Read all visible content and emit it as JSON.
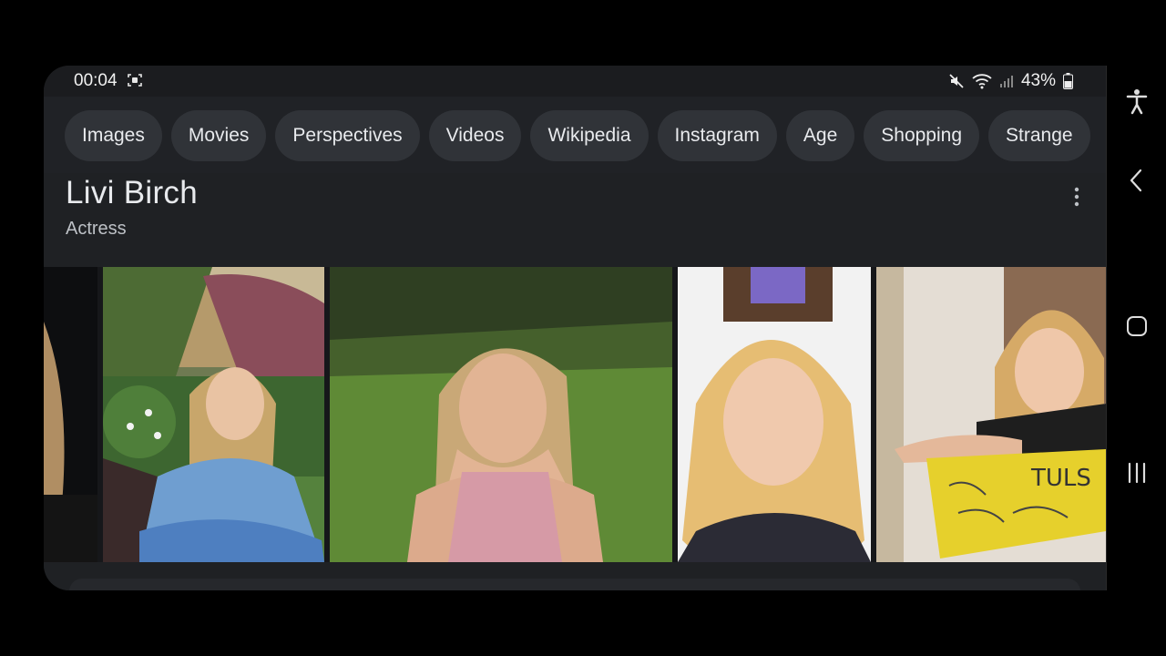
{
  "status_bar": {
    "time": "00:04",
    "battery": "43%",
    "icons": [
      "screen-record-icon",
      "mute-icon",
      "wifi-icon",
      "signal-icon",
      "battery-icon"
    ]
  },
  "chips": [
    {
      "label": "Images"
    },
    {
      "label": "Movies"
    },
    {
      "label": "Perspectives"
    },
    {
      "label": "Videos"
    },
    {
      "label": "Wikipedia"
    },
    {
      "label": "Instagram"
    },
    {
      "label": "Age"
    },
    {
      "label": "Shopping"
    },
    {
      "label": "Strange"
    }
  ],
  "knowledge_panel": {
    "title": "Livi Birch",
    "subtitle": "Actress",
    "menu_icon": "more-vert-icon"
  },
  "images": [
    {
      "description": "partial-photo"
    },
    {
      "description": "girl-in-blue-dress-garden"
    },
    {
      "description": "girl-smiling-on-lawn"
    },
    {
      "description": "girl-headshot-event"
    },
    {
      "description": "girl-with-yellow-sign"
    }
  ],
  "colors": {
    "background": "#1f2124",
    "chip": "#303338",
    "text": "#e8eaed",
    "secondary_text": "#bdc1c6"
  },
  "nav_bar": {
    "icons": [
      "accessibility-icon",
      "back-icon",
      "home-icon",
      "recents-icon"
    ]
  }
}
